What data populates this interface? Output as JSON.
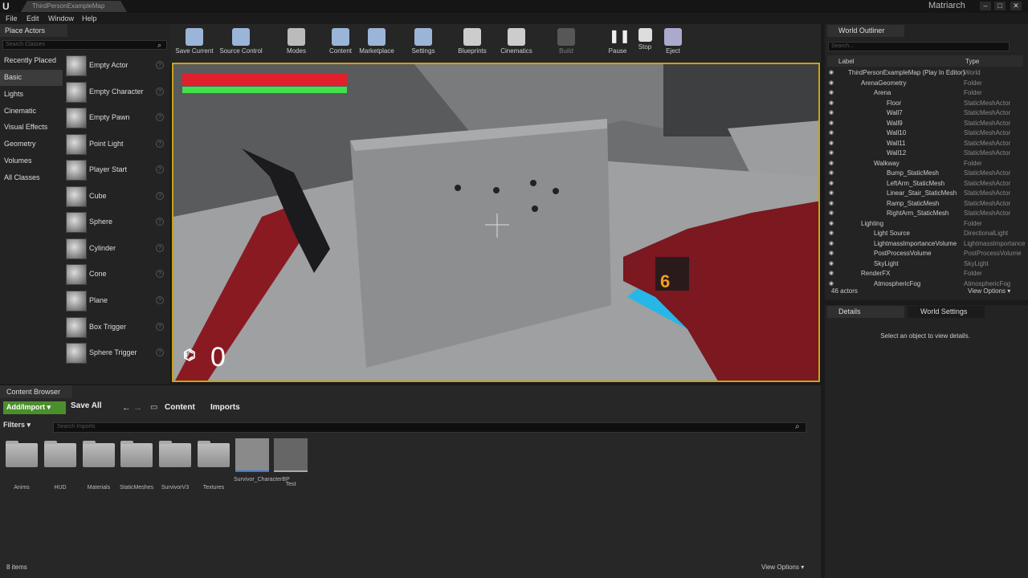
{
  "window": {
    "tab_title": "ThirdPersonExampleMap",
    "project": "Matriarch",
    "controls": [
      "–",
      "□",
      "✕"
    ]
  },
  "menu": [
    "File",
    "Edit",
    "Window",
    "Help"
  ],
  "place_actors": {
    "title": "Place Actors",
    "search_placeholder": "Search Classes",
    "categories": [
      "Recently Placed",
      "Basic",
      "Lights",
      "Cinematic",
      "Visual Effects",
      "Geometry",
      "Volumes",
      "All Classes"
    ],
    "active_category": "Basic",
    "actors": [
      "Empty Actor",
      "Empty Character",
      "Empty Pawn",
      "Point Light",
      "Player Start",
      "Cube",
      "Sphere",
      "Cylinder",
      "Cone",
      "Plane",
      "Box Trigger",
      "Sphere Trigger"
    ]
  },
  "toolbar": [
    "Save Current",
    "Source Control",
    "Modes",
    "Content",
    "Marketplace",
    "Settings",
    "Blueprints",
    "Cinematics",
    "Build",
    "Pause",
    "Stop",
    "Eject"
  ],
  "hud": {
    "ammo_digit": "6",
    "score": "0",
    "health": 1.0,
    "stamina": 1.0
  },
  "content_browser": {
    "title": "Content Browser",
    "add_import": "Add/Import ▾",
    "save_all": "Save All",
    "breadcrumb": [
      "Content",
      "Imports"
    ],
    "filters": "Filters ▾",
    "search_placeholder": "Search Imports",
    "assets": [
      "Anims",
      "HUD",
      "Materials",
      "StaticMeshes",
      "SurvivorV3",
      "Textures",
      "Survivor_CharacterBP",
      "Test"
    ],
    "item_count": "8 items",
    "view_options": "View Options ▾"
  },
  "world_outliner": {
    "title": "World Outliner",
    "search_placeholder": "Search...",
    "col_label": "Label",
    "col_type": "Type",
    "rows": [
      {
        "name": "ThirdPersonExampleMap (Play In Editor)",
        "type": "World"
      },
      {
        "name": "ArenaGeometry",
        "type": "Folder"
      },
      {
        "name": "Arena",
        "type": "Folder"
      },
      {
        "name": "Floor",
        "type": "StaticMeshActor"
      },
      {
        "name": "Wall7",
        "type": "StaticMeshActor"
      },
      {
        "name": "Wall9",
        "type": "StaticMeshActor"
      },
      {
        "name": "Wall10",
        "type": "StaticMeshActor"
      },
      {
        "name": "Wall11",
        "type": "StaticMeshActor"
      },
      {
        "name": "Wall12",
        "type": "StaticMeshActor"
      },
      {
        "name": "Walkway",
        "type": "Folder"
      },
      {
        "name": "Bump_StaticMesh",
        "type": "StaticMeshActor"
      },
      {
        "name": "LeftArm_StaticMesh",
        "type": "StaticMeshActor"
      },
      {
        "name": "Linear_Stair_StaticMesh",
        "type": "StaticMeshActor"
      },
      {
        "name": "Ramp_StaticMesh",
        "type": "StaticMeshActor"
      },
      {
        "name": "RightArm_StaticMesh",
        "type": "StaticMeshActor"
      },
      {
        "name": "Lighting",
        "type": "Folder"
      },
      {
        "name": "Light Source",
        "type": "DirectionalLight"
      },
      {
        "name": "LightmassImportanceVolume",
        "type": "LightmassImportance"
      },
      {
        "name": "PostProcessVolume",
        "type": "PostProcessVolume"
      },
      {
        "name": "SkyLight",
        "type": "SkyLight"
      },
      {
        "name": "RenderFX",
        "type": "Folder"
      },
      {
        "name": "AtmosphericFog",
        "type": "AtmosphericFog"
      }
    ],
    "actor_count": "46 actors",
    "view_options": "View Options ▾"
  },
  "details": {
    "tab": "Details",
    "world_settings_tab": "World Settings",
    "empty_message": "Select an object to view details."
  }
}
